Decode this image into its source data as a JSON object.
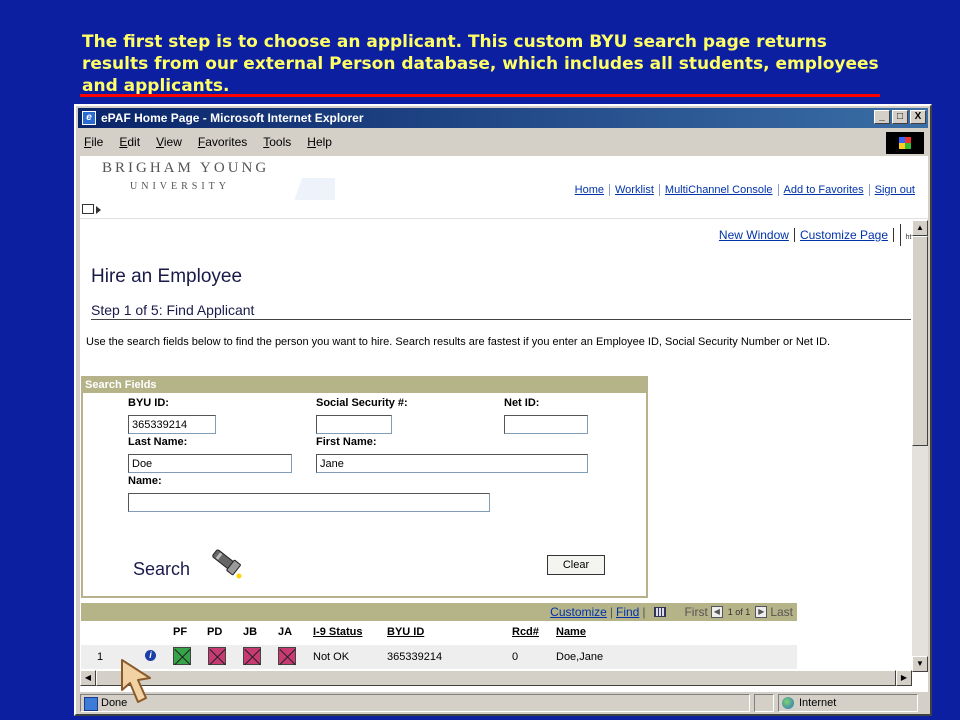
{
  "caption": {
    "text": "The first step is to choose an applicant. This custom BYU search page returns results from our external Person database, which includes all students, employees and applicants."
  },
  "window": {
    "title": "ePAF Home Page - Microsoft Internet Explorer",
    "buttons": [
      "_",
      "□",
      "X"
    ]
  },
  "menu": [
    "File",
    "Edit",
    "View",
    "Favorites",
    "Tools",
    "Help"
  ],
  "byu": {
    "name": "BRIGHAM YOUNG",
    "university": "UNIVERSITY"
  },
  "topnav": [
    "Home",
    "Worklist",
    "MultiChannel Console",
    "Add to Favorites",
    "Sign out"
  ],
  "frame_links": {
    "new_window": "New Window",
    "customize_page": "Customize Page",
    "http_icon": "http"
  },
  "page": {
    "title": "Hire an Employee",
    "step": "Step 1 of 5: Find Applicant",
    "instructions": "Use the search fields below to find the person you want to hire. Search results are fastest if you enter an Employee ID, Social Security Number or Net ID."
  },
  "search_fields": {
    "header": "Search Fields",
    "byu_id_label": "BYU ID:",
    "byu_id_value": "365339214",
    "ssn_label": "Social Security #:",
    "ssn_value": "",
    "net_id_label": "Net ID:",
    "net_id_value": "",
    "last_name_label": "Last Name:",
    "last_name_value": "Doe",
    "first_name_label": "First Name:",
    "first_name_value": "Jane",
    "name_label": "Name:",
    "name_value": "",
    "search_label": "Search",
    "clear_label": "Clear"
  },
  "results": {
    "customize": "Customize",
    "find": "Find",
    "first": "First",
    "page_info": "1 of 1",
    "last": "Last",
    "columns": [
      "PF",
      "PD",
      "JB",
      "JA",
      "I-9 Status",
      "BYU ID",
      "Rcd#",
      "Name"
    ],
    "rows": [
      {
        "num": "1",
        "pf": "checked",
        "pd": "unchecked",
        "jb": "unchecked",
        "ja": "unchecked",
        "i9": "Not OK",
        "byu_id": "365339214",
        "rcd": "0",
        "name": "Doe,Jane"
      }
    ]
  },
  "status": {
    "done": "Done",
    "zone": "Internet"
  },
  "colors": {
    "slide_bg": "#0c1fa0",
    "caption": "#ffff66",
    "rule": "#ff0000",
    "section_bar": "#b5b388",
    "pf_green": "#37a348",
    "flag_pink": "#c83a72"
  },
  "icons": [
    "ie-page-icon",
    "windows-logo-icon",
    "pagelet-menu-icon",
    "http-icon",
    "flashlight-search-icon",
    "grid-download-icon",
    "info-icon",
    "pointer-arrow-icon",
    "internet-zone-icon"
  ]
}
